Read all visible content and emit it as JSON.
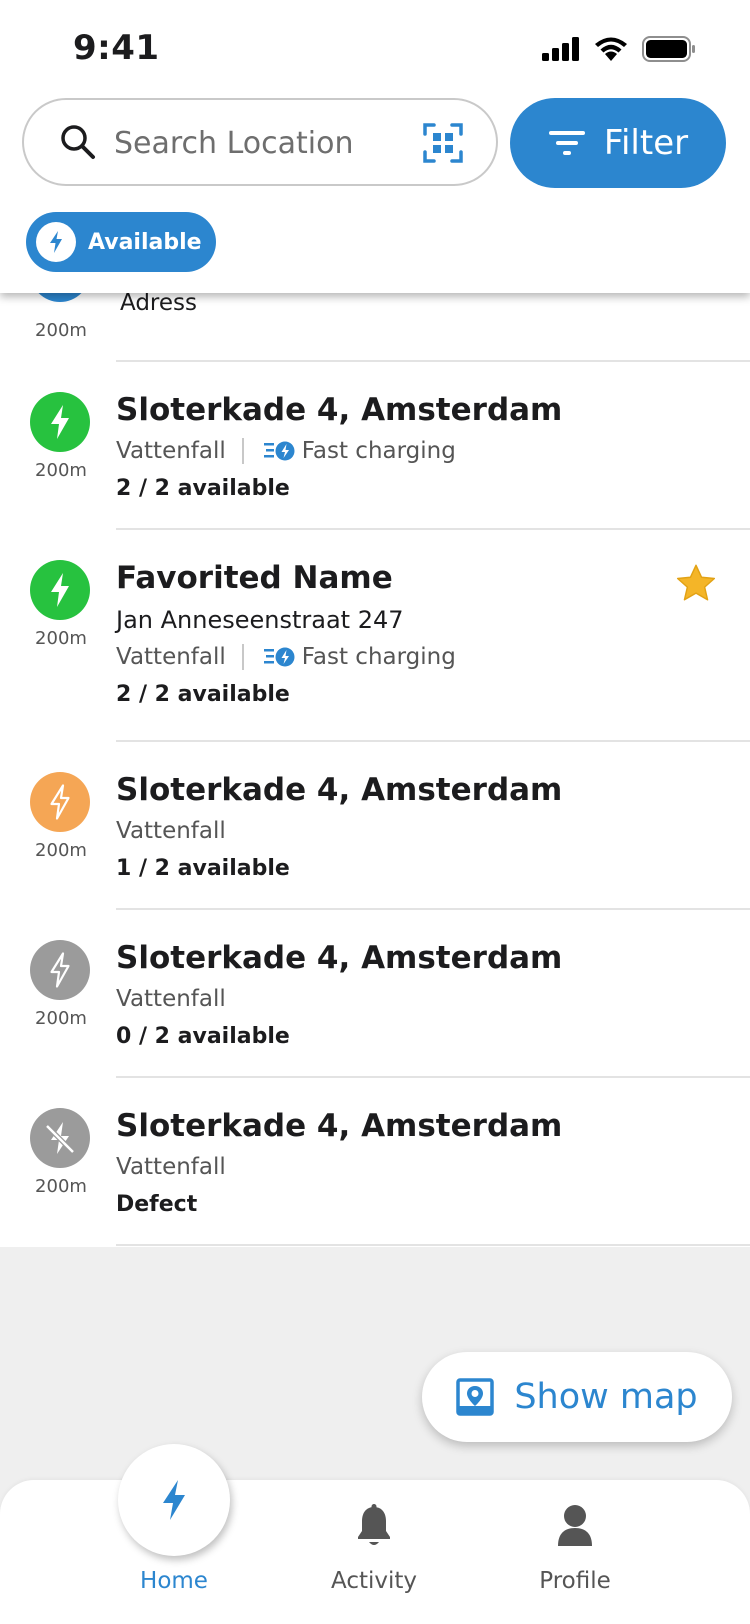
{
  "status_bar": {
    "time": "9:41"
  },
  "search": {
    "placeholder": "Search Location",
    "value": ""
  },
  "filter": {
    "label": "Filter"
  },
  "chips": [
    {
      "label": "Available"
    }
  ],
  "colors": {
    "accent": "#2c86cf",
    "available": "#27c23f",
    "partial": "#f5a655",
    "occupied": "#9b9b9b",
    "defect": "#9b9b9b",
    "favorite": "#f4b528"
  },
  "stations": [
    {
      "status": "available-accent",
      "distance": "200m",
      "address": "Adress"
    },
    {
      "status": "available",
      "distance": "200m",
      "title": "Sloterkade 4, Amsterdam",
      "operator": "Vattenfall",
      "feature": "Fast charging",
      "availability": "2 / 2 available"
    },
    {
      "status": "available",
      "distance": "200m",
      "title": "Favorited Name",
      "address": "Jan Anneseenstraat 247",
      "operator": "Vattenfall",
      "feature": "Fast charging",
      "availability": "2 / 2 available",
      "favorite": true
    },
    {
      "status": "partial",
      "distance": "200m",
      "title": "Sloterkade 4, Amsterdam",
      "operator": "Vattenfall",
      "availability": "1 / 2 available"
    },
    {
      "status": "occupied",
      "distance": "200m",
      "title": "Sloterkade 4, Amsterdam",
      "operator": "Vattenfall",
      "availability": "0 / 2 available"
    },
    {
      "status": "defect",
      "distance": "200m",
      "title": "Sloterkade 4, Amsterdam",
      "operator": "Vattenfall",
      "availability": "Defect"
    }
  ],
  "show_map": {
    "label": "Show map"
  },
  "bottom_nav": {
    "active": "home",
    "items": [
      {
        "key": "home",
        "label": "Home",
        "icon": "bolt-icon"
      },
      {
        "key": "activity",
        "label": "Activity",
        "icon": "bell-icon"
      },
      {
        "key": "profile",
        "label": "Profile",
        "icon": "person-icon"
      }
    ]
  }
}
